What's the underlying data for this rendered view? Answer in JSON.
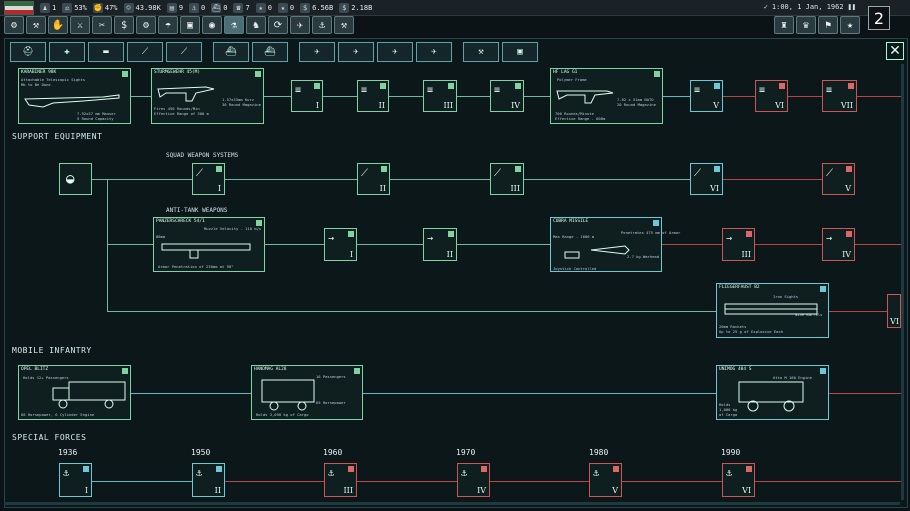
{
  "topbar": {
    "resources": [
      {
        "icon": "manpower-icon",
        "value": "1"
      },
      {
        "icon": "stability-icon",
        "value": "53%"
      },
      {
        "icon": "war-support-icon",
        "value": "47%"
      },
      {
        "icon": "population-icon",
        "value": "43.98K"
      },
      {
        "icon": "factory-icon",
        "value": "9"
      },
      {
        "icon": "dockyard-icon",
        "value": "0"
      },
      {
        "icon": "convoy-icon",
        "value": "0"
      },
      {
        "icon": "phone-icon",
        "value": "7"
      },
      {
        "icon": "star-icon",
        "value": "0"
      },
      {
        "icon": "star2-icon",
        "value": "0"
      },
      {
        "icon": "money-icon",
        "value": "6.56B"
      },
      {
        "icon": "debt-icon",
        "value": "2.18B"
      }
    ],
    "date": "1:00, 1 Jan, 1962",
    "speed": "2"
  },
  "tabs": [
    {
      "name": "tab-infantry-helmet",
      "icon": "⛑"
    },
    {
      "name": "tab-infantry-support",
      "icon": "✚"
    },
    {
      "name": "tab-armor",
      "icon": "▬"
    },
    {
      "name": "tab-artillery",
      "icon": "⟋"
    },
    {
      "name": "tab-naval-1",
      "icon": "⛴"
    },
    {
      "name": "tab-naval-2",
      "icon": "⛴"
    },
    {
      "name": "tab-air-1",
      "icon": "✈"
    },
    {
      "name": "tab-air-2",
      "icon": "✈"
    },
    {
      "name": "tab-air-3",
      "icon": "✈"
    },
    {
      "name": "tab-air-4",
      "icon": "✈"
    },
    {
      "name": "tab-industry",
      "icon": "⚒"
    },
    {
      "name": "tab-electronics",
      "icon": "▣"
    }
  ],
  "sections": {
    "support": "SUPPORT EQUIPMENT",
    "squad": "SQUAD WEAPON SYSTEMS",
    "antitank": "ANTI-TANK WEAPONS",
    "mobile": "MOBILE INFANTRY",
    "special": "SPECIAL FORCES"
  },
  "nodes": {
    "karabiner": {
      "title": "KARABINER 98K",
      "d1": "Attachable Telescopic Sights",
      "d2": "Mk to Be Done",
      "d3": "7.92x57 mm Mauser",
      "d4": "5 Round Capacity"
    },
    "sturmgewehr": {
      "title": "STURMGEWEHR 45(M)",
      "d1": "1.57x33mm Kurz",
      "d2": "30 Round Magazine",
      "d3": "Fires 450 Rounds/Min",
      "d4": "Effective Range of 300 m"
    },
    "hk": {
      "title": "HF LAG G1",
      "d1": "Polymer Frame",
      "d2": "7.62 x 51mm NATO",
      "d3": "20 Round Magazine",
      "d4": "700 Rounds/Minute",
      "d5": "Effective Range - 600m"
    },
    "panzerschreck": {
      "title": "PANZERSCHRECK 54/1",
      "d1": "Muzzle Velocity - 110 m/s",
      "d2": "88mm",
      "d3": "Armor Penetration of 230mm at 90°"
    },
    "cobra": {
      "title": "COBRA MISSILE",
      "d1": "Max Range - 1600 m",
      "d2": "Penetrates 475 mm of Armor",
      "d3": "2.7 kg Warhead",
      "d4": "Joystick Controlled"
    },
    "fliegerfaust": {
      "title": "FLIEGERFAUST B2",
      "d1": "Iron Sights",
      "d2": "Nine Barrels",
      "d3": "20mm Rockets",
      "d4": "Up to 25 g of Explosive Each"
    },
    "opel": {
      "title": "OPEL BLITZ",
      "d1": "Holds 12+ Passengers",
      "d2": "68 Horsepower, 6 Cylinder Engine"
    },
    "hanomag": {
      "title": "HANOMAG AL28",
      "d1": "16 Passengers",
      "d2": "Holds 3,090 kg of Cargo",
      "d3": "65 Horsepower"
    },
    "unimog": {
      "title": "UNIMOG 404 S",
      "d1": "Otto M 180 Engine",
      "d2": "Holds",
      "d3": "1,000 kg",
      "d4": "of Cargo"
    }
  },
  "levels": {
    "i": "I",
    "ii": "II",
    "iii": "III",
    "iv": "IV",
    "v": "V",
    "vi": "VI",
    "vii": "VII"
  },
  "years": [
    "1936",
    "1950",
    "1960",
    "1970",
    "1980",
    "1990"
  ]
}
